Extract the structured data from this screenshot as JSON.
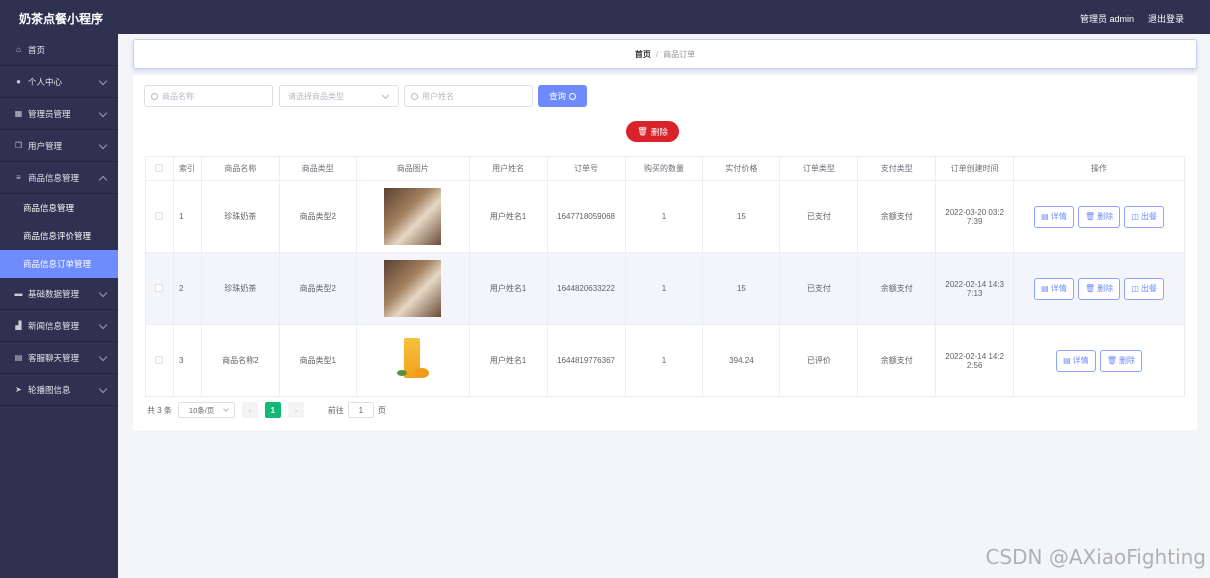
{
  "app": {
    "title": "奶茶点餐小程序",
    "admin_label": "管理员 admin",
    "logout_label": "退出登录"
  },
  "sidebar": {
    "items": [
      {
        "label": "首页",
        "icon": "home-icon",
        "has_children": false
      },
      {
        "label": "个人中心",
        "icon": "user-icon",
        "has_children": true
      },
      {
        "label": "管理员管理",
        "icon": "grid-icon",
        "has_children": true
      },
      {
        "label": "用户管理",
        "icon": "copy-icon",
        "has_children": true
      },
      {
        "label": "商品信息管理",
        "icon": "menu-icon",
        "has_children": true,
        "children": [
          "商品信息管理",
          "商品信息评价管理",
          "商品信息订单管理"
        ],
        "active_child": "商品信息订单管理"
      },
      {
        "label": "基础数据管理",
        "icon": "data-icon",
        "has_children": true
      },
      {
        "label": "新闻信息管理",
        "icon": "chart-icon",
        "has_children": true
      },
      {
        "label": "客服聊天管理",
        "icon": "chat-icon",
        "has_children": true
      },
      {
        "label": "轮播图信息",
        "icon": "send-icon",
        "has_children": true
      }
    ]
  },
  "breadcrumb": {
    "home": "首页",
    "separator": "/",
    "current": "商品订单"
  },
  "search": {
    "product_name_placeholder": "商品名称",
    "product_type_placeholder": "请选择商品类型",
    "user_name_placeholder": "用户姓名",
    "query_label": "查询"
  },
  "delete_label": "删除",
  "table": {
    "headers": [
      "索引",
      "商品名称",
      "商品类型",
      "商品图片",
      "用户姓名",
      "订单号",
      "购买的数量",
      "实付价格",
      "订单类型",
      "支付类型",
      "订单创建时间",
      "操作"
    ],
    "rows": [
      {
        "index": "1",
        "name": "珍珠奶茶",
        "type": "商品类型2",
        "image": "milk-tea",
        "user": "用户姓名1",
        "order_no": "1647718059068",
        "qty": "1",
        "price": "15",
        "order_type": "已支付",
        "pay_type": "余额支付",
        "created_a": "2022-03-20 03:2",
        "created_b": "7:39",
        "actions": [
          "详情",
          "删除",
          "出餐"
        ]
      },
      {
        "index": "2",
        "name": "珍珠奶茶",
        "type": "商品类型2",
        "image": "milk-tea",
        "user": "用户姓名1",
        "order_no": "1644820633222",
        "qty": "1",
        "price": "15",
        "order_type": "已支付",
        "pay_type": "余额支付",
        "created_a": "2022-02-14 14:3",
        "created_b": "7:13",
        "actions": [
          "详情",
          "删除",
          "出餐"
        ]
      },
      {
        "index": "3",
        "name": "商品名称2",
        "type": "商品类型1",
        "image": "juice",
        "user": "用户姓名1",
        "order_no": "1644819776367",
        "qty": "1",
        "price": "394.24",
        "order_type": "已评价",
        "pay_type": "余额支付",
        "created_a": "2022-02-14 14:2",
        "created_b": "2:56",
        "actions": [
          "详情",
          "删除"
        ]
      }
    ]
  },
  "pagination": {
    "total": "共 3 条",
    "page_size": "10条/页",
    "current_page": "1",
    "prev": "‹",
    "next": "›",
    "goto_label": "前往",
    "goto_value": "1",
    "page_suffix": "页"
  },
  "watermark": "CSDN @AXiaoFighting"
}
